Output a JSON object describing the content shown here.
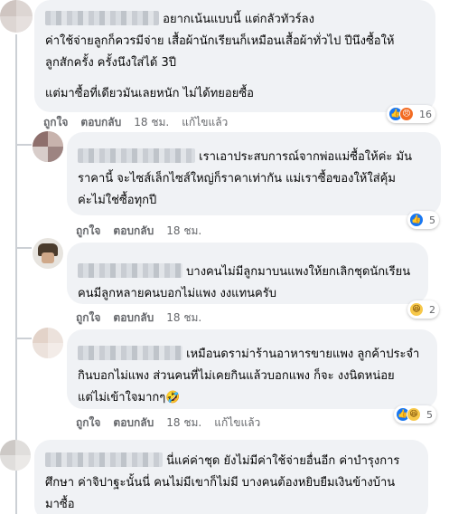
{
  "comments": [
    {
      "text": [
        "อยากเน้นแบบนี้ แต่กลัวทัวร์ลง",
        "ค่าใช้จ่ายลูกก็ควรมีจ่าย เสื้อผ้านักเรียนก็เหมือนเสื้อผ้าทั่วไป ปีนึงซื้อให้",
        "ลูกสักครั้ง ครั้งนึงใส่ได้ 3ปี",
        "แต่มาซื้อที่เดียวมันเลยหนัก ไม่ได้ทยอยซื้อ"
      ],
      "like": "ถูกใจ",
      "reply": "ตอบกลับ",
      "time": "18 ชม.",
      "edited": "แก้ไขแล้ว",
      "reactions": [
        "like-icon",
        "angry-icon"
      ],
      "reaction_count": "16"
    },
    {
      "text": [
        "เราเอาประสบการณ์จากพ่อแม่ซื้อให้ค่ะ มัน",
        "ราคานี้ จะไซส์เล็กไซส์ใหญ่ก็ราคาเท่ากัน แม่เราซื้อของให้ใส่คุ้ม",
        "ค่ะไม่ใช่ซื้อทุกปี"
      ],
      "like": "ถูกใจ",
      "reply": "ตอบกลับ",
      "time": "18 ชม.",
      "reactions": [
        "like-icon"
      ],
      "reaction_count": "5"
    },
    {
      "text": [
        "บางคนไม่มีลูกมาบนแพงให้ยกเลิกชุดนักเรียน",
        "คนมีลูกหลายคนบอกไม่แพง งงแทนครับ"
      ],
      "like": "ถูกใจ",
      "reply": "ตอบกลับ",
      "time": "18 ชม.",
      "reactions": [
        "haha-icon"
      ],
      "reaction_count": "2"
    },
    {
      "text": [
        "เหมือนดราม่าร้านอาหารขายแพง ลูกค้าประจำ",
        "กินบอกไม่แพง ส่วนคนที่ไม่เคยกินแล้วบอกแพง ก็จะ งงนิดหน่อย",
        "แต่ไม่เข้าใจมากๆ🤣"
      ],
      "like": "ถูกใจ",
      "reply": "ตอบกลับ",
      "time": "18 ชม.",
      "edited": "แก้ไขแล้ว",
      "reactions": [
        "like-icon",
        "haha-icon"
      ],
      "reaction_count": "5"
    },
    {
      "text": [
        "นี่แค่ค่าชุด ยังไม่มีค่าใช้จ่ายอื่นอีก ค่าบำรุงการ",
        "ศึกษา ค่าจิปาฐะนั้นนี่ คนไม่มีเขาก็ไม่มี บางคนต้องหยิบยืมเงินข้างบ้าน",
        "มาซื้อ"
      ]
    }
  ]
}
